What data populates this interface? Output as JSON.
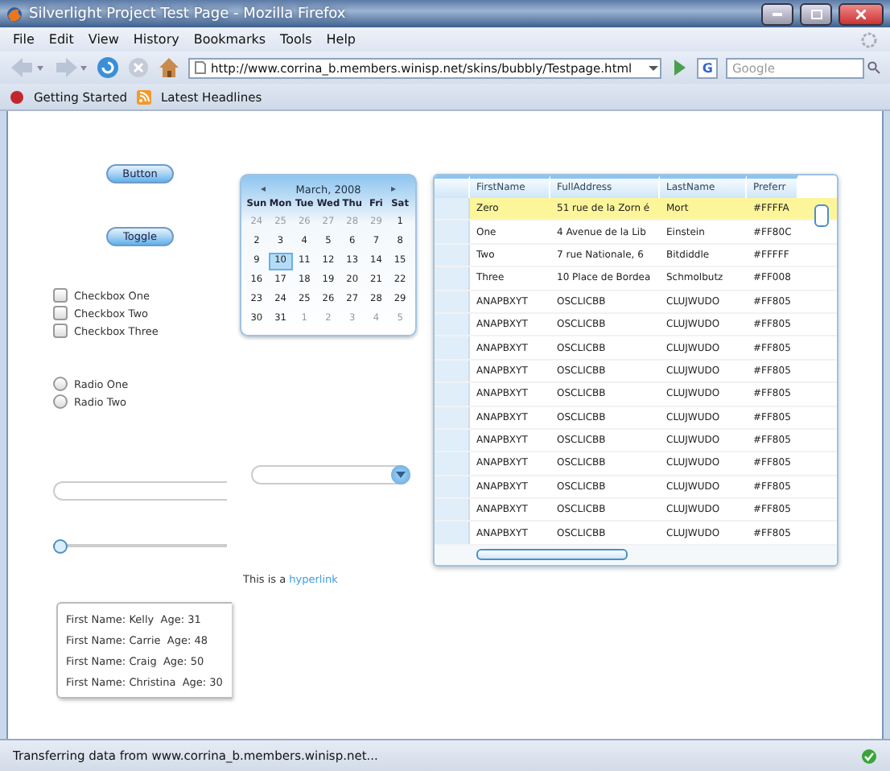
{
  "window": {
    "title": "Silverlight Project Test Page - Mozilla Firefox"
  },
  "menu": [
    "File",
    "Edit",
    "View",
    "History",
    "Bookmarks",
    "Tools",
    "Help"
  ],
  "address": {
    "value": "http://www.corrina_b.members.winisp.net/skins/bubbly/Testpage.html"
  },
  "search": {
    "engine": "G",
    "placeholder": "Google"
  },
  "bookmarks": [
    "Getting Started",
    "Latest Headlines"
  ],
  "page": {
    "buttons": [
      "Button",
      "Toggle"
    ],
    "checkboxes": [
      {
        "label": "Checkbox One",
        "checked": false
      },
      {
        "label": "Checkbox Two",
        "checked": false
      },
      {
        "label": "Checkbox Three",
        "checked": false
      }
    ],
    "radios": [
      {
        "label": "Radio One",
        "selected": false
      },
      {
        "label": "Radio Two",
        "selected": false
      }
    ],
    "slider": {
      "level": 0
    },
    "calendar": {
      "prev": "◂",
      "title": "March, 2008",
      "next": "▸",
      "weekdays": [
        "Sun",
        "Mon",
        "Tue",
        "Wed",
        "Thu",
        "Fri",
        "Sat"
      ],
      "weeks": [
        [
          {
            "day": "24",
            "other_month": true,
            "selected": false
          },
          {
            "day": "25",
            "other_month": true,
            "selected": false
          },
          {
            "day": "26",
            "other_month": true,
            "selected": false
          },
          {
            "day": "27",
            "other_month": true,
            "selected": false
          },
          {
            "day": "28",
            "other_month": true,
            "selected": false
          },
          {
            "day": "29",
            "other_month": true,
            "selected": false
          },
          {
            "day": "1",
            "other_month": false,
            "selected": false
          }
        ],
        [
          {
            "day": "2",
            "other_month": false,
            "selected": false
          },
          {
            "day": "3",
            "other_month": false,
            "selected": false
          },
          {
            "day": "4",
            "other_month": false,
            "selected": false
          },
          {
            "day": "5",
            "other_month": false,
            "selected": false
          },
          {
            "day": "6",
            "other_month": false,
            "selected": false
          },
          {
            "day": "7",
            "other_month": false,
            "selected": false
          },
          {
            "day": "8",
            "other_month": false,
            "selected": false
          }
        ],
        [
          {
            "day": "9",
            "other_month": false,
            "selected": false
          },
          {
            "day": "10",
            "other_month": false,
            "selected": true
          },
          {
            "day": "11",
            "other_month": false,
            "selected": false
          },
          {
            "day": "12",
            "other_month": false,
            "selected": false
          },
          {
            "day": "13",
            "other_month": false,
            "selected": false
          },
          {
            "day": "14",
            "other_month": false,
            "selected": false
          },
          {
            "day": "15",
            "other_month": false,
            "selected": false
          }
        ],
        [
          {
            "day": "16",
            "other_month": false,
            "selected": false
          },
          {
            "day": "17",
            "other_month": false,
            "selected": false
          },
          {
            "day": "18",
            "other_month": false,
            "selected": false
          },
          {
            "day": "19",
            "other_month": false,
            "selected": false
          },
          {
            "day": "20",
            "other_month": false,
            "selected": false
          },
          {
            "day": "21",
            "other_month": false,
            "selected": false
          },
          {
            "day": "22",
            "other_month": false,
            "selected": false
          }
        ],
        [
          {
            "day": "23",
            "other_month": false,
            "selected": false
          },
          {
            "day": "24",
            "other_month": false,
            "selected": false
          },
          {
            "day": "25",
            "other_month": false,
            "selected": false
          },
          {
            "day": "26",
            "other_month": false,
            "selected": false
          },
          {
            "day": "27",
            "other_month": false,
            "selected": false
          },
          {
            "day": "28",
            "other_month": false,
            "selected": false
          },
          {
            "day": "29",
            "other_month": false,
            "selected": false
          }
        ],
        [
          {
            "day": "30",
            "other_month": false,
            "selected": false
          },
          {
            "day": "31",
            "other_month": false,
            "selected": false
          },
          {
            "day": "1",
            "other_month": true,
            "selected": false
          },
          {
            "day": "2",
            "other_month": true,
            "selected": false
          },
          {
            "day": "3",
            "other_month": true,
            "selected": false
          },
          {
            "day": "4",
            "other_month": true,
            "selected": false
          },
          {
            "day": "5",
            "other_month": true,
            "selected": false
          }
        ]
      ]
    },
    "grid": {
      "columns": [
        "FirstName",
        "FullAddress",
        "LastName",
        "Preferr"
      ],
      "rows": [
        {
          "selected": true,
          "cells": [
            "Zero",
            "51 rue de la Zorn é",
            "Mort",
            "#FFFFA"
          ]
        },
        {
          "selected": false,
          "cells": [
            "One",
            "4 Avenue de la Lib",
            "Einstein",
            "#FF80C"
          ]
        },
        {
          "selected": false,
          "cells": [
            "Two",
            "7 rue Nationale, 6",
            "Bitdiddle",
            "#FFFFF"
          ]
        },
        {
          "selected": false,
          "cells": [
            "Three",
            "10 Place de Bordea",
            "Schmolbutz",
            "#FF008"
          ]
        },
        {
          "selected": false,
          "cells": [
            "ANAPBXYT",
            "OSCLICBB",
            "CLUJWUDO",
            "#FF805"
          ]
        },
        {
          "selected": false,
          "cells": [
            "ANAPBXYT",
            "OSCLICBB",
            "CLUJWUDO",
            "#FF805"
          ]
        },
        {
          "selected": false,
          "cells": [
            "ANAPBXYT",
            "OSCLICBB",
            "CLUJWUDO",
            "#FF805"
          ]
        },
        {
          "selected": false,
          "cells": [
            "ANAPBXYT",
            "OSCLICBB",
            "CLUJWUDO",
            "#FF805"
          ]
        },
        {
          "selected": false,
          "cells": [
            "ANAPBXYT",
            "OSCLICBB",
            "CLUJWUDO",
            "#FF805"
          ]
        },
        {
          "selected": false,
          "cells": [
            "ANAPBXYT",
            "OSCLICBB",
            "CLUJWUDO",
            "#FF805"
          ]
        },
        {
          "selected": false,
          "cells": [
            "ANAPBXYT",
            "OSCLICBB",
            "CLUJWUDO",
            "#FF805"
          ]
        },
        {
          "selected": false,
          "cells": [
            "ANAPBXYT",
            "OSCLICBB",
            "CLUJWUDO",
            "#FF805"
          ]
        },
        {
          "selected": false,
          "cells": [
            "ANAPBXYT",
            "OSCLICBB",
            "CLUJWUDO",
            "#FF805"
          ]
        },
        {
          "selected": false,
          "cells": [
            "ANAPBXYT",
            "OSCLICBB",
            "CLUJWUDO",
            "#FF805"
          ]
        },
        {
          "selected": false,
          "cells": [
            "ANAPBXYT",
            "OSCLICBB",
            "CLUJWUDO",
            "#FF805"
          ]
        }
      ]
    },
    "hyperlink": {
      "prefix": "This is a",
      "link": "hyperlink"
    },
    "people": [
      {
        "name_label": "First Name:",
        "name": "Kelly",
        "age_label": "Age:",
        "age": "31"
      },
      {
        "name_label": "First Name:",
        "name": "Carrie",
        "age_label": "Age:",
        "age": "48"
      },
      {
        "name_label": "First Name:",
        "name": "Craig",
        "age_label": "Age:",
        "age": "50"
      },
      {
        "name_label": "First Name:",
        "name": "Christina",
        "age_label": "Age:",
        "age": "30"
      }
    ]
  },
  "status_bar": {
    "text": "Transferring data from www.corrina_b.members.winisp.net..."
  }
}
